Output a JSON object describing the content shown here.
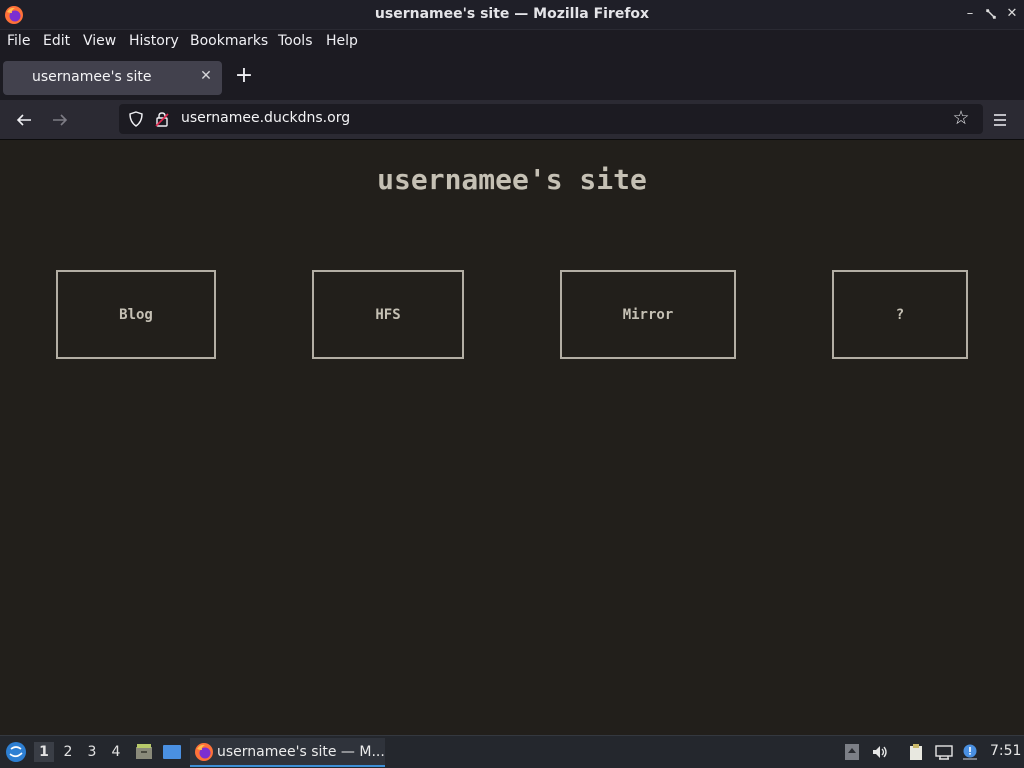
{
  "window": {
    "title": "usernamee's site — Mozilla Firefox",
    "controls": [
      "minimize-icon",
      "restore-icon",
      "close-icon"
    ]
  },
  "menubar": {
    "items": [
      {
        "label": "File"
      },
      {
        "label": "Edit"
      },
      {
        "label": "View"
      },
      {
        "label": "History"
      },
      {
        "label": "Bookmarks"
      },
      {
        "label": "Tools"
      },
      {
        "label": "Help"
      }
    ]
  },
  "tabs": [
    {
      "label": "usernamee's site",
      "active": true
    }
  ],
  "navbar": {
    "url": "usernamee.duckdns.org",
    "forward_enabled": false
  },
  "page": {
    "title": "usernamee's site",
    "links": [
      {
        "label": "Blog"
      },
      {
        "label": "HFS"
      },
      {
        "label": "Mirror"
      },
      {
        "label": "?"
      }
    ]
  },
  "taskbar": {
    "workspaces": [
      "1",
      "2",
      "3",
      "4"
    ],
    "active_workspace": "1",
    "task_label": "usernamee's site — M...",
    "clock": "7:51"
  },
  "colors": {
    "page_background": "#221f1b",
    "page_text": "#c5c0b4",
    "link_border": "#b3aea4",
    "taskbar_accent": "#3d8fd6"
  }
}
